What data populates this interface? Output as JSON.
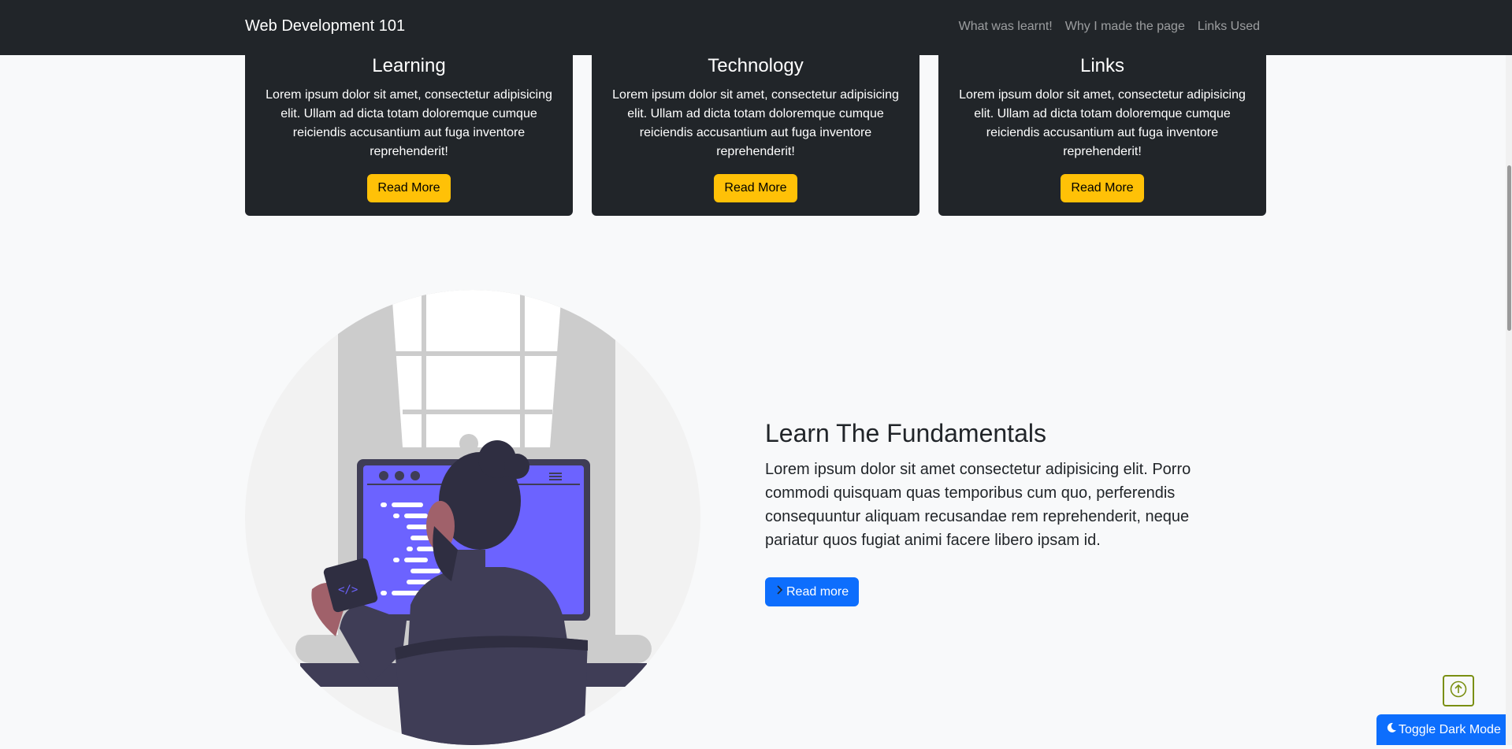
{
  "navbar": {
    "brand": "Web Development 101",
    "links": [
      "What was learnt!",
      "Why I made the page",
      "Links Used"
    ]
  },
  "cards": [
    {
      "title": "Learning",
      "text": "Lorem ipsum dolor sit amet, consectetur adipisicing elit. Ullam ad dicta totam doloremque cumque reiciendis accusantium aut fuga inventore reprehenderit!",
      "button": "Read More"
    },
    {
      "title": "Technology",
      "text": "Lorem ipsum dolor sit amet, consectetur adipisicing elit. Ullam ad dicta totam doloremque cumque reiciendis accusantium aut fuga inventore reprehenderit!",
      "button": "Read More"
    },
    {
      "title": "Links",
      "text": "Lorem ipsum dolor sit amet, consectetur adipisicing elit. Ullam ad dicta totam doloremque cumque reiciendis accusantium aut fuga inventore reprehenderit!",
      "button": "Read More"
    }
  ],
  "hero": {
    "title": "Learn The Fundamentals",
    "lead": "Lorem ipsum dolor sit amet consectetur adipisicing elit. Porro commodi quisquam quas temporibus cum quo, perferendis consequuntur aliquam recusandae rem reprehenderit, neque pariatur quos fugiat animi facere libero ipsam id.",
    "button": "Read more",
    "code_glyph": "</>"
  },
  "toggle_dark": "Toggle Dark Mode",
  "icons": {
    "hero_button_icon": "chevron-right-icon",
    "to_top_icon": "arrow-up-icon",
    "toggle_icon": "moon-icon",
    "illustration": "person-coding-illustration"
  },
  "colors": {
    "navbar_bg": "#212529",
    "card_bg": "#212529",
    "warning": "#ffc107",
    "primary": "#0d6efd",
    "page_bg": "#f8f9fa",
    "screen": "#6c63ff",
    "to_top_border": "#7a8f12"
  }
}
